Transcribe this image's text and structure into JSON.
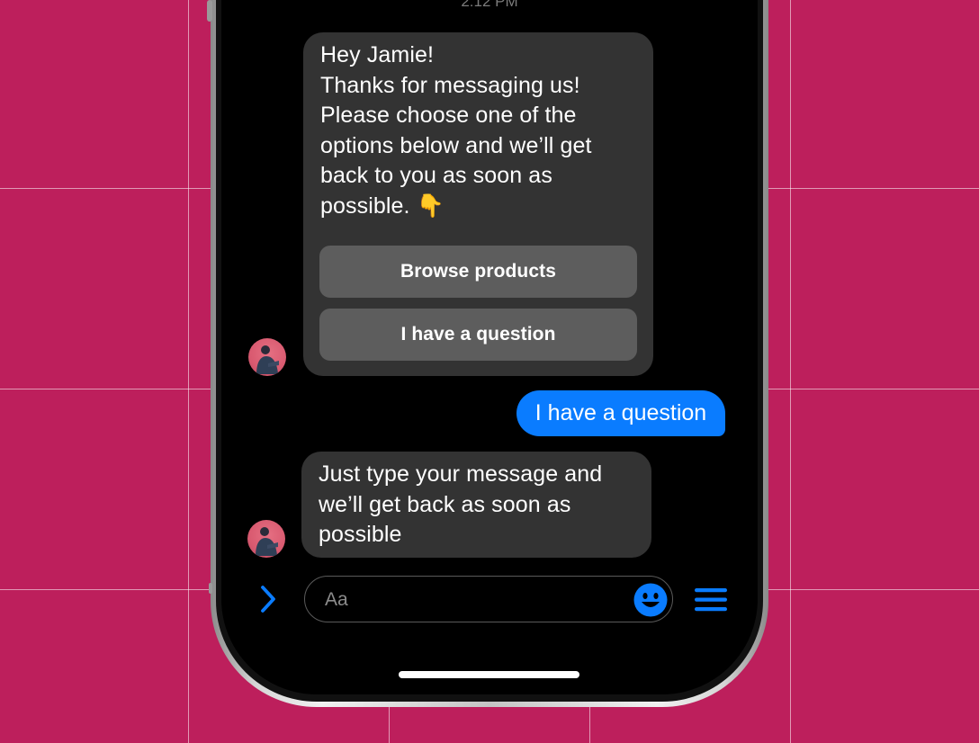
{
  "conversation": {
    "timestamp": "2:12 PM",
    "bot_greeting": {
      "text": "Hey Jamie!\nThanks for messaging us!\nPlease choose one of the\noptions below and we’ll get\nback to you as soon as\npossible. 👇",
      "quick_replies": [
        "Browse products",
        "I have a question"
      ]
    },
    "user_reply": "I have a question",
    "bot_followup": "Just type your message and\nwe’ll get back as soon as\npossible"
  },
  "composer": {
    "placeholder": "Aa",
    "icons": [
      "chevron-right-icon",
      "smiley-icon",
      "menu-icon"
    ]
  },
  "colors": {
    "background": "#bd1f5c",
    "incoming_bubble": "#333333",
    "quick_reply": "#5d5d5d",
    "outgoing_bubble": "#0a7cff",
    "accent": "#0a7cff"
  }
}
